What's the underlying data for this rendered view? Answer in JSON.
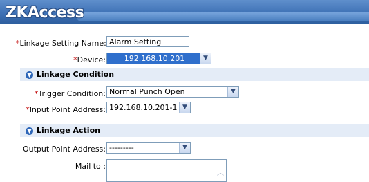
{
  "app": {
    "logo_text": "ZKAccess"
  },
  "form": {
    "linkage_name": {
      "label": "Linkage Setting Name:",
      "value": "Alarm Setting"
    },
    "device": {
      "label": "Device:",
      "value": "192.168.10.201"
    },
    "sections": {
      "condition": "Linkage Condition",
      "action": "Linkage Action"
    },
    "trigger": {
      "label": "Trigger Condition:",
      "value": "Normal Punch Open"
    },
    "input_point": {
      "label": "Input Point Address:",
      "value": "192.168.10.201-1"
    },
    "output_point": {
      "label": "Output Point Address:",
      "value": "---------"
    },
    "mail": {
      "label": "Mail to :"
    }
  },
  "icons": {
    "dropdown": "chevron-down-icon",
    "section": "collapse-icon",
    "scroll": "scroll-up-icon"
  },
  "colors": {
    "required": "#c00000",
    "banner": "#3f72b6",
    "section_bg": "#e4ecf7",
    "selected_bg": "#2f6fcc"
  }
}
